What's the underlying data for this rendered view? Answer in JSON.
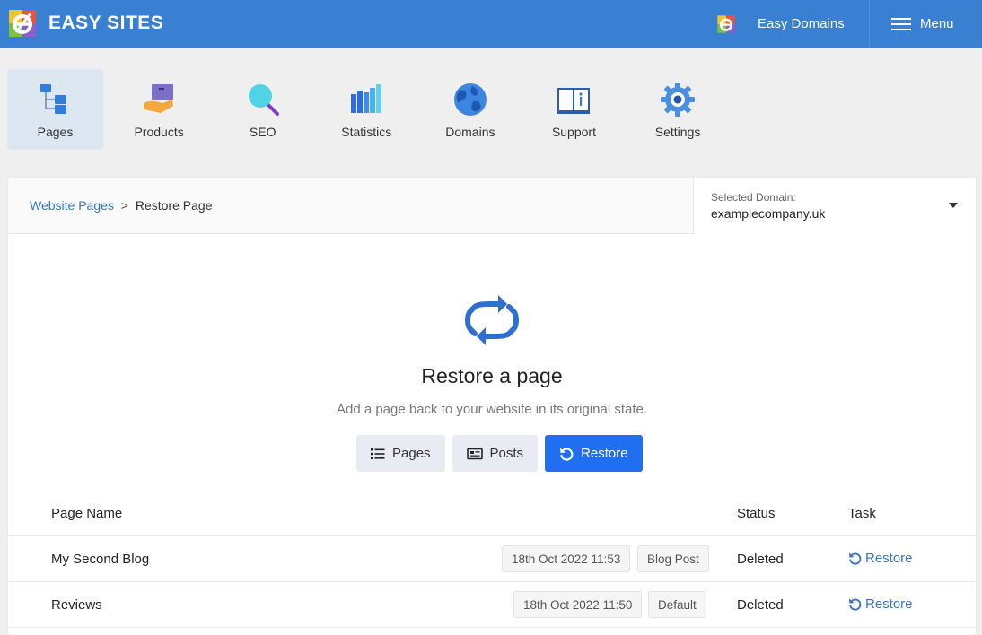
{
  "app": {
    "name": "EASY SITES"
  },
  "header": {
    "domains_label": "Easy Domains",
    "menu_label": "Menu"
  },
  "nav": {
    "items": [
      {
        "label": "Pages",
        "icon": "pages-icon",
        "active": true
      },
      {
        "label": "Products",
        "icon": "products-icon"
      },
      {
        "label": "SEO",
        "icon": "seo-icon"
      },
      {
        "label": "Statistics",
        "icon": "statistics-icon"
      },
      {
        "label": "Domains",
        "icon": "domains-icon"
      },
      {
        "label": "Support",
        "icon": "support-icon"
      },
      {
        "label": "Settings",
        "icon": "settings-icon"
      }
    ]
  },
  "breadcrumb": {
    "parent": "Website Pages",
    "separator": ">",
    "current": "Restore Page"
  },
  "domain_select": {
    "caption": "Selected Domain:",
    "value": "examplecompany.uk"
  },
  "hero": {
    "title": "Restore a page",
    "subtitle": "Add a page back to your website in its original state."
  },
  "tabs": {
    "pages": "Pages",
    "posts": "Posts",
    "restore": "Restore"
  },
  "table": {
    "headers": {
      "name": "Page Name",
      "status": "Status",
      "task": "Task"
    },
    "rows": [
      {
        "name": "My Second Blog",
        "date": "18th Oct 2022 11:53",
        "type": "Blog Post",
        "status": "Deleted",
        "task": "Restore"
      },
      {
        "name": "Reviews",
        "date": "18th Oct 2022 11:50",
        "type": "Default",
        "status": "Deleted",
        "task": "Restore"
      }
    ]
  },
  "colors": {
    "brand": "#3a80d2",
    "primary_button": "#1f6ff0",
    "link": "#3a74c2"
  }
}
